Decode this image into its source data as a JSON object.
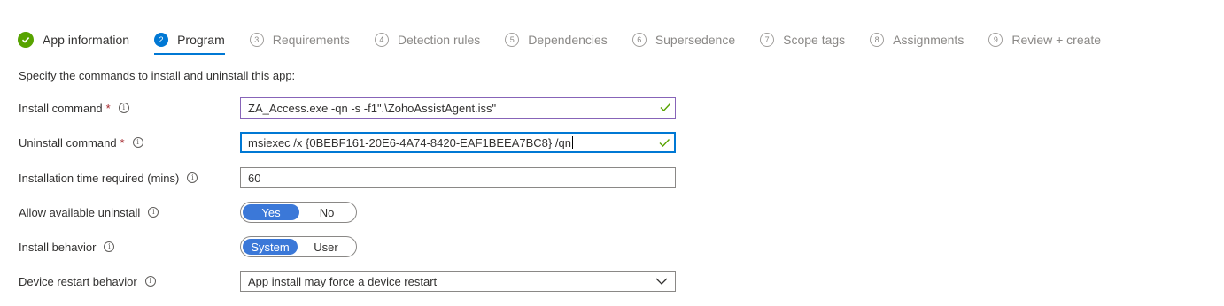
{
  "steps": [
    {
      "num": "",
      "label": "App information",
      "state": "done"
    },
    {
      "num": "2",
      "label": "Program",
      "state": "current"
    },
    {
      "num": "3",
      "label": "Requirements",
      "state": "pending"
    },
    {
      "num": "4",
      "label": "Detection rules",
      "state": "pending"
    },
    {
      "num": "5",
      "label": "Dependencies",
      "state": "pending"
    },
    {
      "num": "6",
      "label": "Supersedence",
      "state": "pending"
    },
    {
      "num": "7",
      "label": "Scope tags",
      "state": "pending"
    },
    {
      "num": "8",
      "label": "Assignments",
      "state": "pending"
    },
    {
      "num": "9",
      "label": "Review + create",
      "state": "pending"
    }
  ],
  "intro": "Specify the commands to install and uninstall this app:",
  "required_marker": "*",
  "info_glyph": "i",
  "form": {
    "install_command": {
      "label": "Install command",
      "value": "ZA_Access.exe -qn -s -f1\".\\ZohoAssistAgent.iss\""
    },
    "uninstall_command": {
      "label": "Uninstall command",
      "value": "msiexec /x {0BEBF161-20E6-4A74-8420-EAF1BEEA7BC8} /qn"
    },
    "install_time": {
      "label": "Installation time required (mins)",
      "value": "60"
    },
    "allow_uninstall": {
      "label": "Allow available uninstall",
      "options": [
        "Yes",
        "No"
      ],
      "selected": "Yes"
    },
    "install_behavior": {
      "label": "Install behavior",
      "options": [
        "System",
        "User"
      ],
      "selected": "System"
    },
    "restart_behavior": {
      "label": "Device restart behavior",
      "value": "App install may force a device restart"
    }
  },
  "colors": {
    "accent": "#0078d4",
    "success": "#57a300",
    "required": "#a4262c"
  }
}
